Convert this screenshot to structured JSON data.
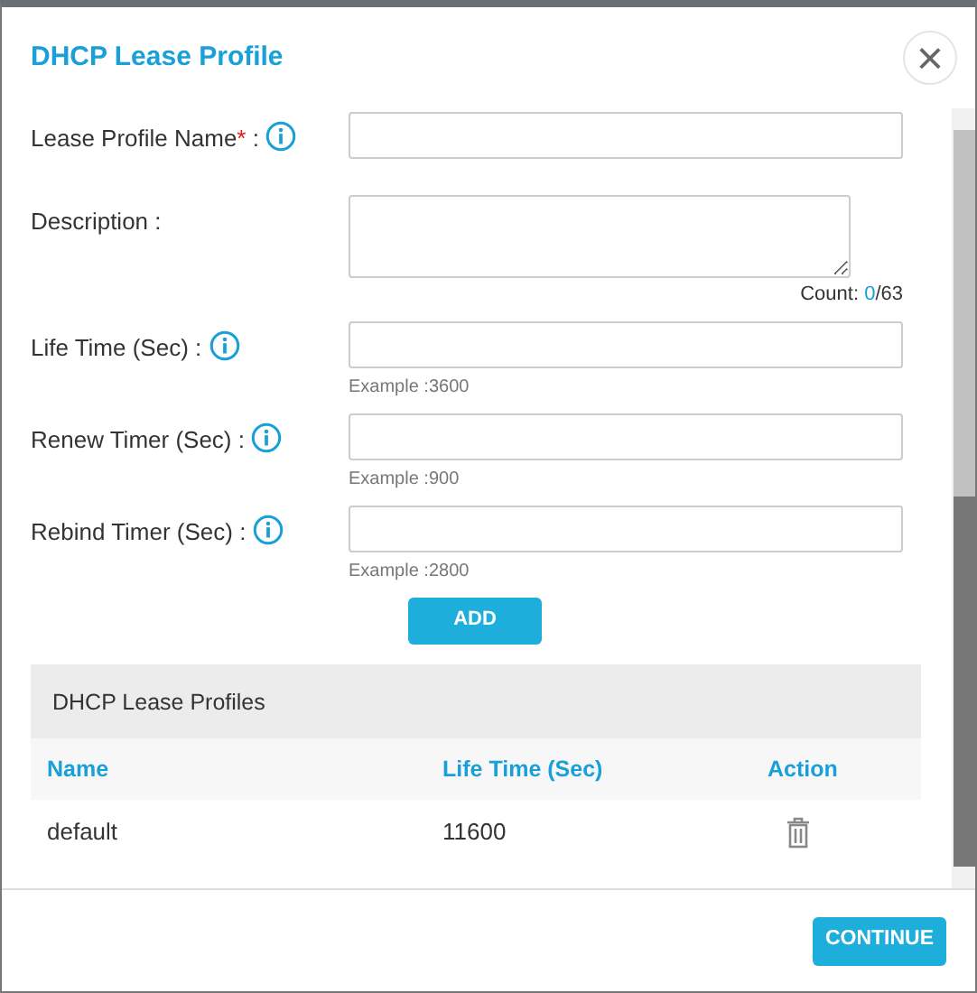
{
  "dialog": {
    "title": "DHCP Lease Profile",
    "close_label": "×"
  },
  "fields": [
    {
      "kind": "text",
      "label": "Lease Profile Name",
      "required_mark": "*",
      "suffix": " :",
      "info": true
    },
    {
      "kind": "textarea",
      "label": "Description :",
      "info": false,
      "count_label": "Count: ",
      "count_value": "0",
      "count_max": "/63"
    },
    {
      "kind": "text",
      "label": "Life Time (Sec) :",
      "info": true,
      "example": "Example :3600"
    },
    {
      "kind": "text",
      "label": "Renew Timer (Sec) :",
      "info": true,
      "example": "Example :900"
    },
    {
      "kind": "text",
      "label": "Rebind Timer (Sec) :",
      "info": true,
      "example": "Example :2800"
    }
  ],
  "add_button": "ADD",
  "table": {
    "title": "DHCP Lease Profiles",
    "columns": [
      "Name",
      "Life Time (Sec)",
      "Action"
    ],
    "rows": [
      {
        "name": "default",
        "life_time": "11600"
      }
    ]
  },
  "footer": {
    "continue_button": "CONTINUE"
  }
}
